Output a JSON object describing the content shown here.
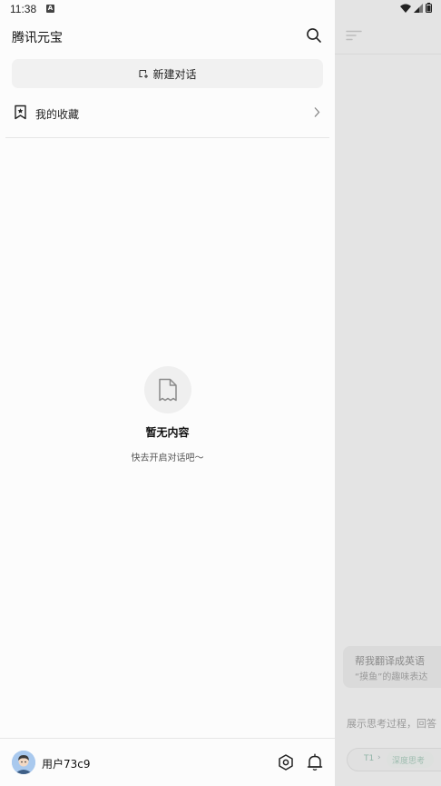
{
  "status_bar": {
    "time": "11:38",
    "notification_letter": "A"
  },
  "drawer": {
    "title": "腾讯元宝",
    "new_chat_label": "新建对话",
    "favorites_label": "我的收藏",
    "empty_title": "暂无内容",
    "empty_subtitle": "快去开启对话吧～",
    "username": "用户73c9"
  },
  "main": {
    "suggestion_title": "帮我翻译成英语",
    "suggestion_subtitle": "“摸鱼”的趣味表达",
    "input_placeholder": "展示思考过程，回答",
    "model_name": "T1",
    "model_caret": "›",
    "deep_think_label": "深度思考"
  },
  "colors": {
    "drawer_bg": "#fcfcfc",
    "overlay_bg": "#e4e4e4",
    "button_bg": "#f1f1f1",
    "accent_green": "#8fb3a6"
  },
  "icons": {
    "search": "search-icon",
    "new_chat": "new-chat-icon",
    "favorites": "bookmark-star-icon",
    "chevron": "chevron-right-icon",
    "empty": "document-icon",
    "settings": "hexagon-settings-icon",
    "bell": "bell-icon",
    "menu": "menu-icon"
  }
}
